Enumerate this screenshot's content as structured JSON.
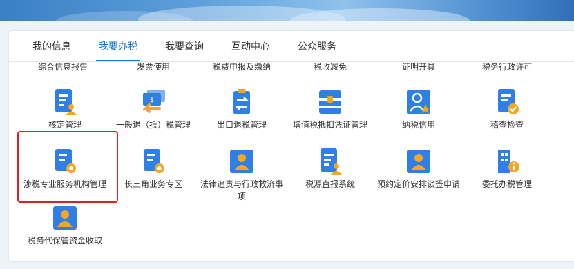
{
  "tabs": [
    "我的信息",
    "我要办税",
    "我要查询",
    "互动中心",
    "公众服务"
  ],
  "active_tab": "我要办税",
  "categories": [
    "综合信息报告",
    "发票使用",
    "税费申报及缴纳",
    "税收减免",
    "证明开具",
    "税务行政许可"
  ],
  "services": [
    {
      "label": "核定管理",
      "icon": "document-person-icon"
    },
    {
      "label": "一般退（抵）税管理",
      "icon": "refund-cards-icon"
    },
    {
      "label": "出口退税管理",
      "icon": "export-refund-clipboard-icon"
    },
    {
      "label": "增值税抵扣凭证管理",
      "icon": "vat-deduction-box-icon"
    },
    {
      "label": "纳税信用",
      "icon": "person-star-icon"
    },
    {
      "label": "稽查检查",
      "icon": "document-check-icon"
    },
    {
      "label": "涉税专业服务机构管理",
      "icon": "document-gear-icon"
    },
    {
      "label": "长三角业务专区",
      "icon": "document-gear-icon"
    },
    {
      "label": "法律追责与行政救济事项",
      "icon": "person-card-icon"
    },
    {
      "label": "税源直报系统",
      "icon": "document-person-icon"
    },
    {
      "label": "预约定价安排谈签申请",
      "icon": "person-card-icon"
    },
    {
      "label": "委托办税管理",
      "icon": "building-info-icon"
    },
    {
      "label": "税务代保管资金收取",
      "icon": "person-card-icon"
    }
  ],
  "colors": {
    "accent": "#1d6fd6",
    "icon_blue": "#2f7fe6",
    "icon_orange": "#f5a623",
    "highlight": "#e02020"
  }
}
